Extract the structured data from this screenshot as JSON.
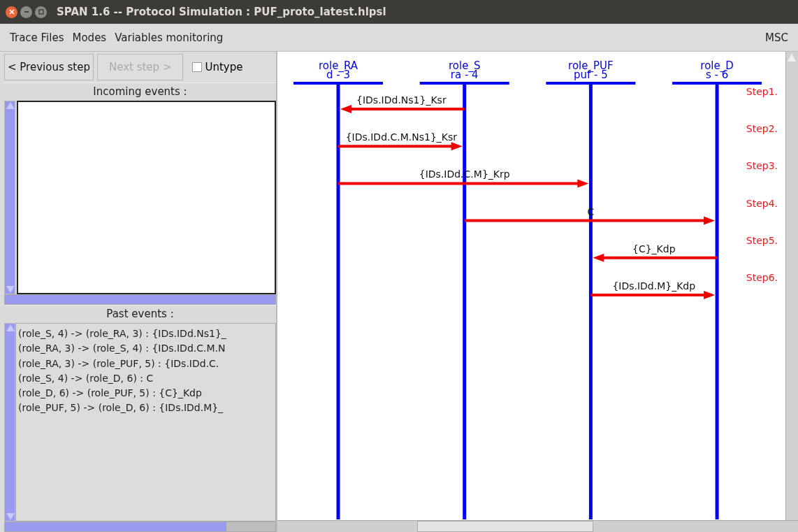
{
  "window": {
    "title": "SPAN 1.6 -- Protocol Simulation : PUF_proto_latest.hlpsl"
  },
  "menu": [
    "Trace Files",
    "Modes",
    "Variables monitoring"
  ],
  "menu_right": "MSC",
  "toolbar": {
    "buttons": [
      {
        "label": "< Previous step",
        "disabled": false
      },
      {
        "label": "Next step >",
        "disabled": true
      }
    ],
    "checkbox": {
      "label": "Untype",
      "checked": false
    }
  },
  "incoming_events": {
    "title": "Incoming events :"
  },
  "past_events": {
    "title": "Past events :",
    "items": [
      "(role_S, 4) -> (role_RA, 3) : {IDs.IDd.Ns1}_",
      "(role_RA, 3) -> (role_S, 4) : {IDs.IDd.C.M.N",
      "(role_RA, 3) -> (role_PUF, 5) : {IDs.IDd.C.",
      "(role_S, 4) -> (role_D, 6) : C",
      "(role_D, 6) -> (role_PUF, 5) : {C}_Kdp",
      "(role_PUF, 5) -> (role_D, 6) : {IDs.IDd.M}_"
    ]
  },
  "msc": {
    "roles": [
      {
        "name": "role_RA",
        "sub": "d - 3"
      },
      {
        "name": "role_S",
        "sub": "ra - 4"
      },
      {
        "name": "role_PUF",
        "sub": "puf - 5"
      },
      {
        "name": "role_D",
        "sub": "s - 6"
      }
    ],
    "messages": [
      {
        "lanes": [
          {
            "kind": "head"
          },
          {
            "kind": "tail"
          },
          {
            "kind": "none"
          },
          {
            "kind": "none"
          }
        ],
        "label": "{IDs.IDd.Ns1}_Ksr",
        "step": "Step1."
      },
      {
        "lanes": [
          {
            "kind": "tail"
          },
          {
            "kind": "head"
          },
          {
            "kind": "none"
          },
          {
            "kind": "none"
          }
        ],
        "label": "{IDs.IDd.C.M.Ns1}_Ksr",
        "step": "Step2."
      },
      {
        "lanes": [
          {
            "kind": "tail"
          },
          {
            "kind": "none"
          },
          {
            "kind": "head"
          },
          {
            "kind": "none"
          }
        ],
        "label": "{IDs.IDd.C.M}_Krp",
        "step": "Step3."
      },
      {
        "lanes": [
          {
            "kind": "none"
          },
          {
            "kind": "tail"
          },
          {
            "kind": "none"
          },
          {
            "kind": "head"
          }
        ],
        "label": "C",
        "step": "Step4."
      },
      {
        "lanes": [
          {
            "kind": "none"
          },
          {
            "kind": "none"
          },
          {
            "kind": "head"
          },
          {
            "kind": "tail"
          }
        ],
        "label": "{C}_Kdp",
        "step": "Step5."
      },
      {
        "lanes": [
          {
            "kind": "none"
          },
          {
            "kind": "none"
          },
          {
            "kind": "tail"
          },
          {
            "kind": "head"
          }
        ],
        "label": "{IDs.IDd.M}_Kdp",
        "step": "Step6."
      }
    ]
  }
}
